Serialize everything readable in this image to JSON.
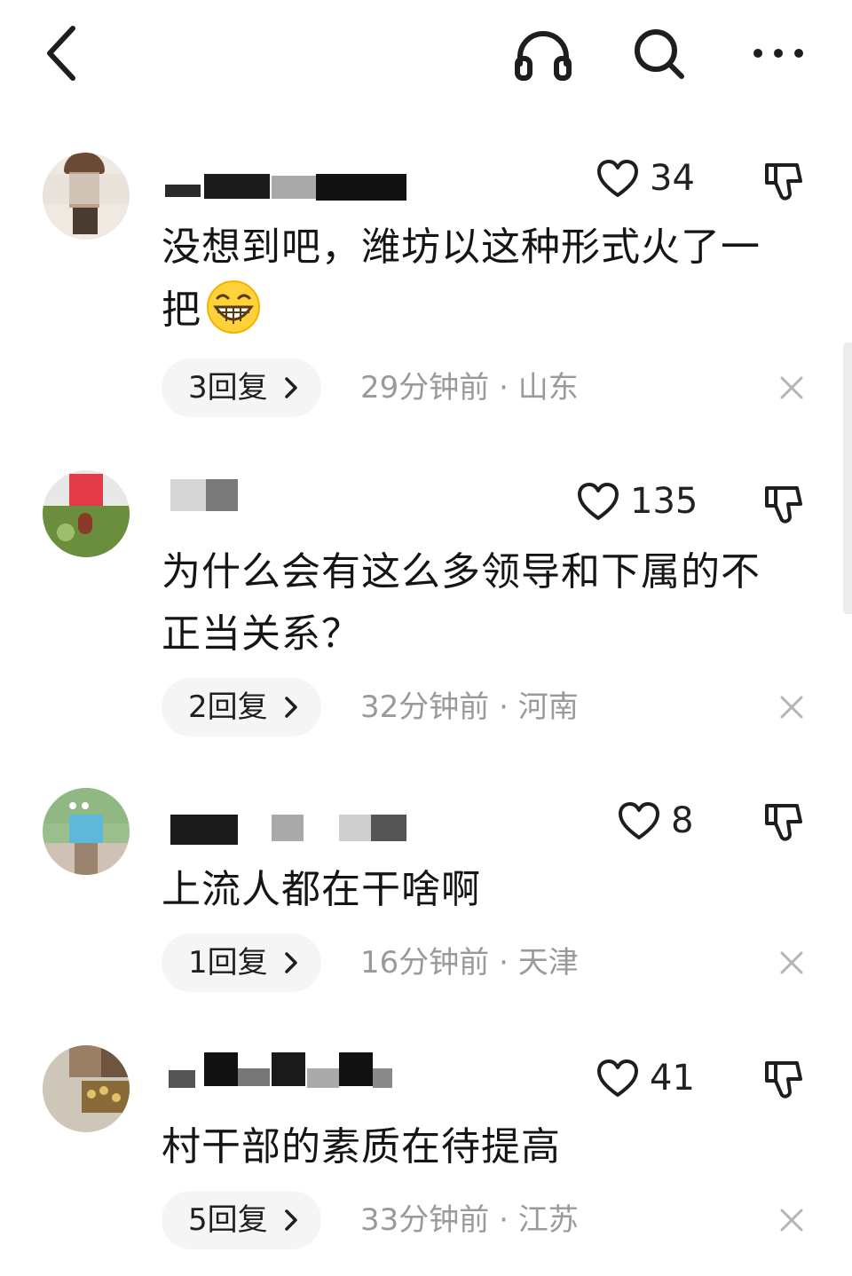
{
  "topbar": {
    "back_icon": "chevron-left-icon",
    "listen_icon": "headphones-icon",
    "search_icon": "search-icon",
    "more_icon": "more-dots-icon"
  },
  "comments": [
    {
      "username": "",
      "likes": "34",
      "text_line1": "没想到吧，潍坊以这种形式火了一",
      "text_line2": "把",
      "emoji": "grinning-face-icon",
      "replies": "3回复",
      "time": "29分钟前",
      "separator": "·",
      "location": "山东"
    },
    {
      "username": "",
      "likes": "135",
      "text_line1": "为什么会有这么多领导和下属的不",
      "text_line2": "正当关系？",
      "replies": "2回复",
      "time": "32分钟前",
      "separator": "·",
      "location": "河南"
    },
    {
      "username": "",
      "likes": "8",
      "text_line1": "上流人都在干啥啊",
      "replies": "1回复",
      "time": "16分钟前",
      "separator": "·",
      "location": "天津"
    },
    {
      "username": "",
      "likes": "41",
      "text_line1": "村干部的素质在待提高",
      "replies": "5回复",
      "time": "33分钟前",
      "separator": "·",
      "location": "江苏"
    }
  ],
  "colors": {
    "text": "#151515",
    "meta": "#9a9a9a",
    "pill_bg": "#f5f5f5",
    "icon_stroke": "#1e1e1e"
  }
}
